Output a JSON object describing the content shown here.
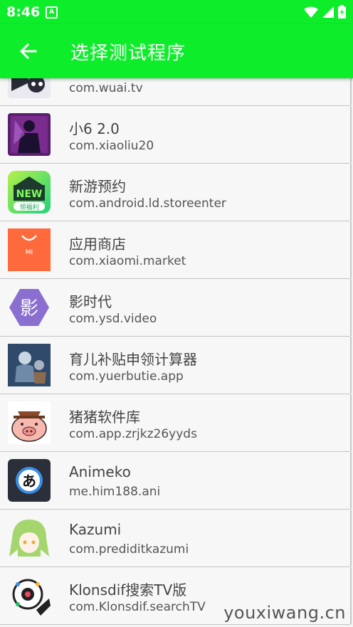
{
  "status_bar": {
    "time": "8:46",
    "notification_letter": "A",
    "icons": [
      "wifi-icon",
      "signal-icon",
      "battery-charging-icon"
    ]
  },
  "app_bar": {
    "title": "选择测试程序",
    "back_icon": "arrow-back-icon",
    "color": "#0ded2a"
  },
  "apps": [
    {
      "name": "",
      "package": "com.wuai.tv"
    },
    {
      "name": "小6 2.0",
      "package": "com.xiaoliu20"
    },
    {
      "name": "新游预约",
      "package": "com.android.ld.storeenter"
    },
    {
      "name": "应用商店",
      "package": "com.xiaomi.market"
    },
    {
      "name": "影时代",
      "package": "com.ysd.video"
    },
    {
      "name": "育儿补贴申领计算器",
      "package": "com.yuerbutie.app"
    },
    {
      "name": "猪猪软件库",
      "package": "com.app.zrjkz26yyds"
    },
    {
      "name": "Animeko",
      "package": "me.him188.ani"
    },
    {
      "name": "Kazumi",
      "package": "com.prediditkazumi"
    },
    {
      "name": "Klonsdif搜索TV版",
      "package": "com.Klonsdif.searchTV"
    }
  ],
  "icon_labels": {
    "xindianyuyue_new": "NEW",
    "xindianyuyue_sub": "领福利",
    "xiaomi_mi": "MI",
    "yingshidai": "影",
    "animeko": "あ"
  },
  "watermark": "youxiwang.cn"
}
